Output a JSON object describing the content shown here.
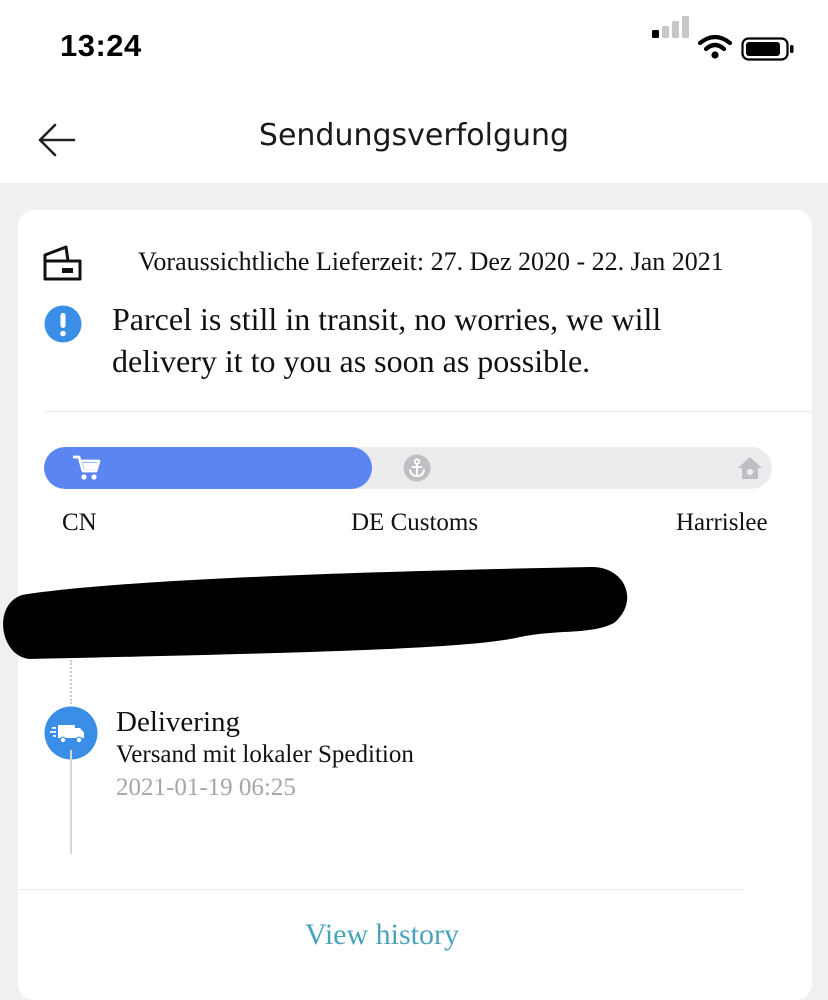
{
  "status_bar": {
    "time": "13:24",
    "signal_icon": "cellular-signal-icon",
    "wifi_icon": "wifi-icon",
    "battery_icon": "battery-icon"
  },
  "header": {
    "back_icon": "arrow-left-icon",
    "title": "Sendungsverfolgung"
  },
  "shipment": {
    "eta_icon": "parcel-card-icon",
    "eta_text": "Voraussichtliche Lieferzeit: 27. Dez 2020 - 22. Jan 2021",
    "alert_icon": "exclamation-circle-icon",
    "alert_text": "Parcel is still in transit, no worries, we will delivery it to you as soon as possible."
  },
  "progress": {
    "fraction": 0.45,
    "fill_color": "#5b86f2",
    "track_color": "#ececee",
    "stages": [
      {
        "label": "CN",
        "icon": "shopping-cart-icon",
        "reached": true
      },
      {
        "label": "DE Customs",
        "icon": "anchor-icon",
        "reached": false
      },
      {
        "label": "Harrislee",
        "icon": "home-icon",
        "reached": false
      }
    ]
  },
  "timeline": {
    "events": [
      {
        "icon": "delivery-truck-icon",
        "title": "Delivering",
        "description": "Versand mit lokaler Spedition",
        "timestamp": "2021-01-19 06:25"
      }
    ]
  },
  "view_history_label": "View history",
  "colors": {
    "accent_blue": "#3b8ee8",
    "progress_blue": "#5b86f2",
    "link_teal": "#4aa3b8"
  }
}
